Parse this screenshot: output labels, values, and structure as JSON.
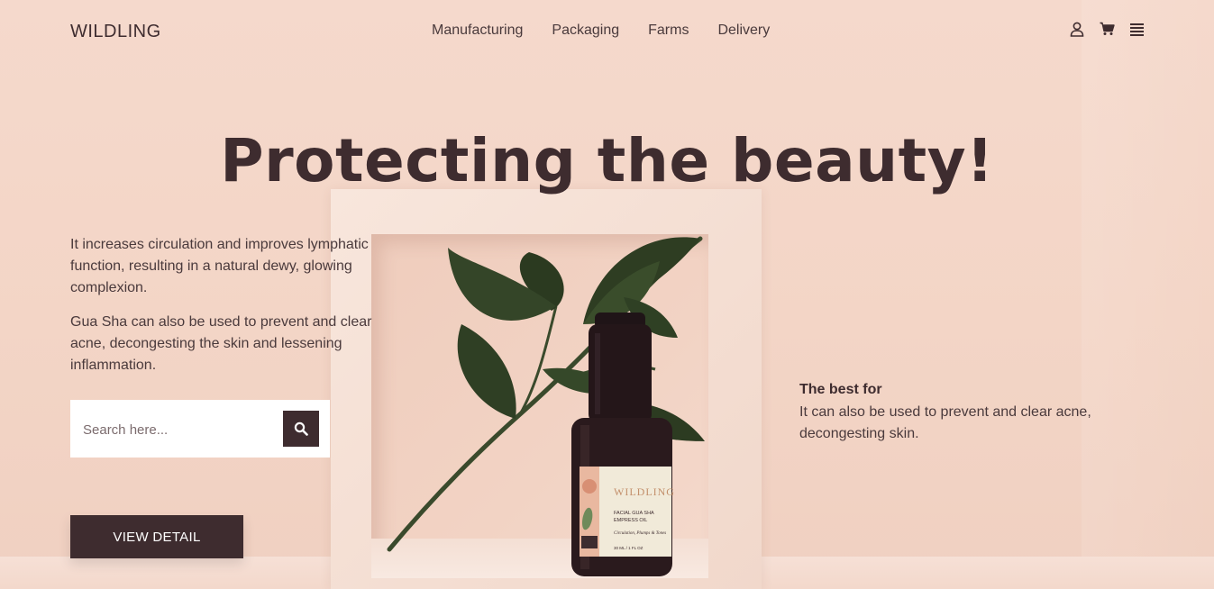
{
  "brand": {
    "logo": "WILDLING"
  },
  "nav": {
    "items": [
      "Manufacturing",
      "Packaging",
      "Farms",
      "Delivery"
    ]
  },
  "header_icons": [
    "user-icon",
    "cart-icon",
    "menu-icon"
  ],
  "hero": {
    "title": "Protecting the beauty!",
    "paragraphs": [
      "It increases circulation and improves lymphatic function, resulting in a natural dewy, glowing complexion.",
      "Gua Sha can also be used to prevent and clear acne, decongesting the skin and lessening inflammation."
    ],
    "search": {
      "placeholder": "Search here...",
      "icon": "search-icon"
    },
    "cta": "VIEW DETAIL"
  },
  "feature": {
    "heading": "The best for",
    "text": "It can also be used to prevent and clear acne, decongesting skin."
  },
  "product_label": {
    "brand": "WILDLING",
    "name_line1": "FACIAL GUA SHA",
    "name_line2": "EMPRESS OIL",
    "tagline": "Circulation, Plumps & Tones",
    "size": "30 ML / 1 FL OZ"
  },
  "colors": {
    "primary": "#3e2c2f",
    "background": "#f4d7c9",
    "white": "#ffffff"
  }
}
